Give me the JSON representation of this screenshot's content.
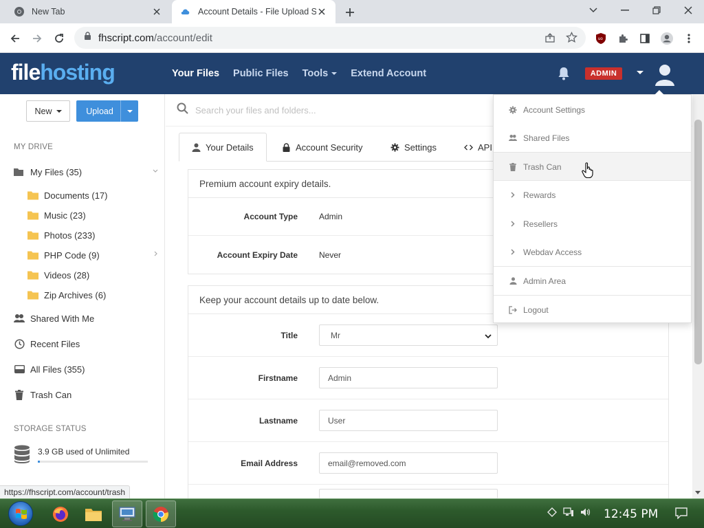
{
  "browser": {
    "tabs": [
      {
        "title": "New Tab",
        "active": false
      },
      {
        "title": "Account Details - File Upload Script",
        "active": true
      }
    ],
    "url_host": "fhscript.com",
    "url_path": "/account/edit",
    "status_url": "https://fhscript.com/account/trash"
  },
  "header": {
    "logo_part1": "file",
    "logo_part2": "hosting",
    "nav": [
      {
        "label": "Your Files",
        "current": true
      },
      {
        "label": "Public Files",
        "current": false
      },
      {
        "label": "Tools",
        "current": false,
        "dropdown": true
      },
      {
        "label": "Extend Account",
        "current": false
      }
    ],
    "admin_badge": "ADMIN"
  },
  "sidebar": {
    "new_label": "New",
    "upload_label": "Upload",
    "my_drive_heading": "MY DRIVE",
    "my_files": "My Files (35)",
    "folders": [
      {
        "label": "Documents (17)",
        "has_children": false
      },
      {
        "label": "Music (23)",
        "has_children": false
      },
      {
        "label": "Photos (233)",
        "has_children": false
      },
      {
        "label": "PHP Code (9)",
        "has_children": true
      },
      {
        "label": "Videos (28)",
        "has_children": false
      },
      {
        "label": "Zip Archives (6)",
        "has_children": false
      }
    ],
    "shared_with_me": "Shared With Me",
    "recent_files": "Recent Files",
    "all_files": "All Files (355)",
    "trash_can": "Trash Can",
    "storage_heading": "STORAGE STATUS",
    "storage_text": "3.9 GB used of Unlimited",
    "storage_fill_fraction": 0.02
  },
  "main": {
    "search_placeholder": "Search your files and folders...",
    "tabs": [
      {
        "label": "Your Details",
        "icon": "user-icon",
        "active": true
      },
      {
        "label": "Account Security",
        "icon": "lock-icon",
        "active": false
      },
      {
        "label": "Settings",
        "icon": "gear-icon",
        "active": false
      },
      {
        "label": "API",
        "icon": "code-icon",
        "active": false
      }
    ],
    "premium_panel": {
      "heading": "Premium account expiry details.",
      "rows": [
        {
          "label": "Account Type",
          "value": "Admin"
        },
        {
          "label": "Account Expiry Date",
          "value": "Never"
        }
      ]
    },
    "details_panel": {
      "heading": "Keep your account details up to date below.",
      "fields": [
        {
          "label": "Title",
          "value": "Mr",
          "type": "select"
        },
        {
          "label": "Firstname",
          "value": "Admin",
          "type": "input"
        },
        {
          "label": "Lastname",
          "value": "User",
          "type": "input"
        },
        {
          "label": "Email Address",
          "value": "email@removed.com",
          "type": "input"
        }
      ]
    }
  },
  "user_menu": {
    "items": [
      {
        "label": "Account Settings",
        "icon": "gear-icon"
      },
      {
        "label": "Shared Files",
        "icon": "users-icon"
      },
      {
        "label": "Trash Can",
        "icon": "trash-icon",
        "hovered": true
      },
      {
        "label": "Rewards",
        "icon": "chevron-right-icon"
      },
      {
        "label": "Resellers",
        "icon": "chevron-right-icon"
      },
      {
        "label": "Webdav Access",
        "icon": "chevron-right-icon"
      },
      {
        "label": "Admin Area",
        "icon": "user-icon"
      },
      {
        "label": "Logout",
        "icon": "logout-icon"
      }
    ]
  },
  "taskbar": {
    "clock": "12:45 PM"
  },
  "colors": {
    "header_bg": "#21416e",
    "logo_accent": "#5aaef0",
    "upload_button": "#3f8fdc",
    "admin_badge": "#c9302c"
  }
}
